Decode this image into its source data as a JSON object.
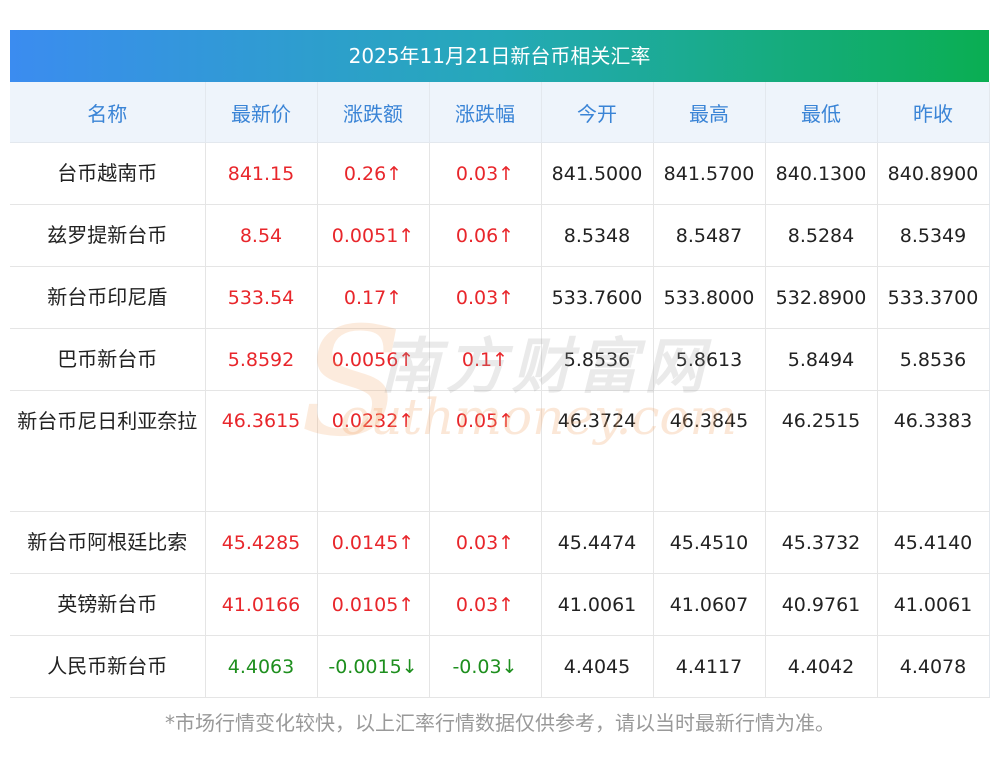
{
  "title": "2025年11月21日新台币相关汇率",
  "columns": [
    "名称",
    "最新价",
    "涨跌额",
    "涨跌幅",
    "今开",
    "最高",
    "最低",
    "昨收"
  ],
  "rows": [
    {
      "name": "台币越南币",
      "latest": "841.15",
      "change": "0.26↑",
      "pct": "0.03↑",
      "open": "841.5000",
      "high": "841.5700",
      "low": "840.1300",
      "prev": "840.8900",
      "dir": "up"
    },
    {
      "name": "兹罗提新台币",
      "latest": "8.54",
      "change": "0.0051↑",
      "pct": "0.06↑",
      "open": "8.5348",
      "high": "8.5487",
      "low": "8.5284",
      "prev": "8.5349",
      "dir": "up"
    },
    {
      "name": "新台币印尼盾",
      "latest": "533.54",
      "change": "0.17↑",
      "pct": "0.03↑",
      "open": "533.7600",
      "high": "533.8000",
      "low": "532.8900",
      "prev": "533.3700",
      "dir": "up"
    },
    {
      "name": "巴币新台币",
      "latest": "5.8592",
      "change": "0.0056↑",
      "pct": "0.1↑",
      "open": "5.8536",
      "high": "5.8613",
      "low": "5.8494",
      "prev": "5.8536",
      "dir": "up"
    },
    {
      "name": "新台币尼日利亚奈拉",
      "latest": "46.3615",
      "change": "0.0232↑",
      "pct": "0.05↑",
      "open": "46.3724",
      "high": "46.3845",
      "low": "46.2515",
      "prev": "46.3383",
      "dir": "up"
    },
    {
      "name": "新台币阿根廷比索",
      "latest": "45.4285",
      "change": "0.0145↑",
      "pct": "0.03↑",
      "open": "45.4474",
      "high": "45.4510",
      "low": "45.3732",
      "prev": "45.4140",
      "dir": "up"
    },
    {
      "name": "英镑新台币",
      "latest": "41.0166",
      "change": "0.0105↑",
      "pct": "0.03↑",
      "open": "41.0061",
      "high": "41.0607",
      "low": "40.9761",
      "prev": "41.0061",
      "dir": "up"
    },
    {
      "name": "人民币新台币",
      "latest": "4.4063",
      "change": "-0.0015↓",
      "pct": "-0.03↓",
      "open": "4.4045",
      "high": "4.4117",
      "low": "4.4042",
      "prev": "4.4078",
      "dir": "down"
    }
  ],
  "footer": "*市场行情变化较快，以上汇率行情数据仅供参考，请以当时最新行情为准。",
  "watermark": {
    "cn": "南方财富网",
    "en": "outhmoney.com",
    "s": "S"
  },
  "colors": {
    "up": "#e8262b",
    "down": "#1e8f1e",
    "header_text": "#3a84d6",
    "title_gradient_start": "#3b8cf0",
    "title_gradient_end": "#0aae52"
  }
}
